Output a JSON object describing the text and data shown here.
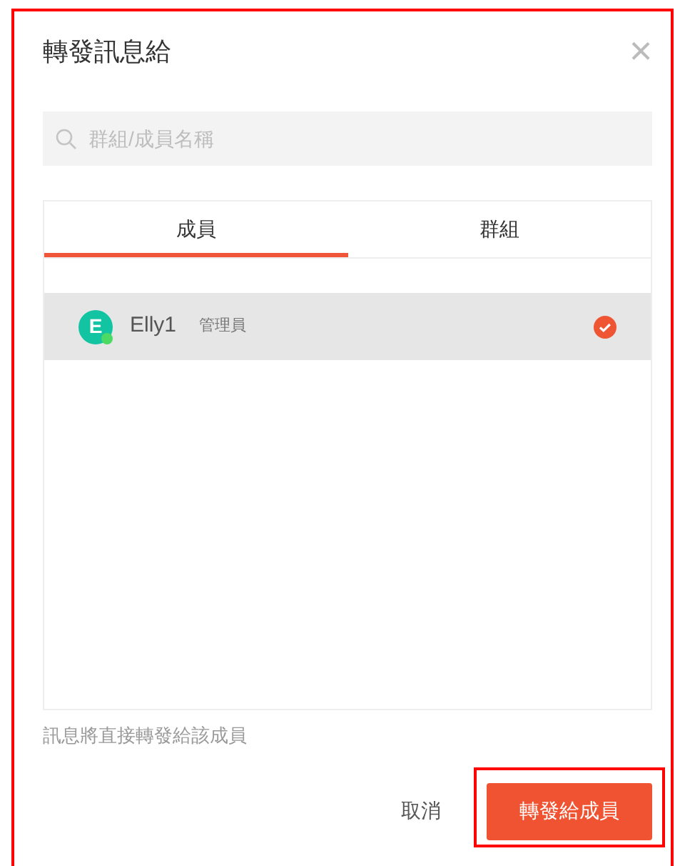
{
  "dialog": {
    "title": "轉發訊息給",
    "close": "×"
  },
  "search": {
    "placeholder": "群組/成員名稱"
  },
  "tabs": [
    {
      "label": "成員",
      "selected": true
    },
    {
      "label": "群組",
      "selected": false
    }
  ],
  "members": [
    {
      "initial": "E",
      "name": "Elly1",
      "role": "管理員",
      "online": true,
      "selected": true
    }
  ],
  "note": "訊息將直接轉發給該成員",
  "buttons": [
    {
      "kind": "cancel",
      "label": "取消"
    },
    {
      "kind": "primary",
      "label": "轉發給成員"
    }
  ]
}
